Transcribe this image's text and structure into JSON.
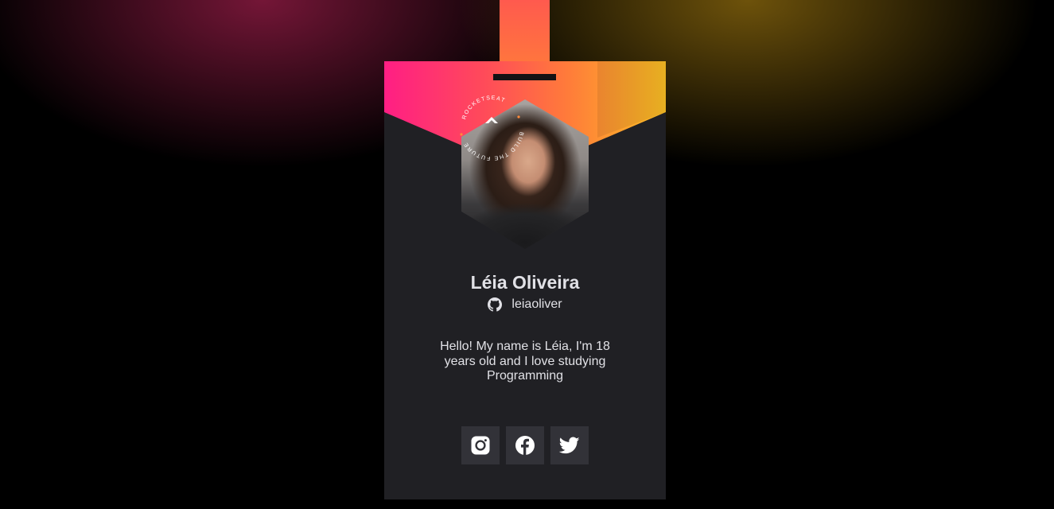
{
  "profile": {
    "name": "Léia Oliveira",
    "github_username": "leiaoliver",
    "bio": "Hello! My name is Léia, I'm 18 years old and I love studying Programming",
    "badge_text_top": "ROCKETSEAT",
    "badge_text_bottom": "BUILD THE FUTURE"
  },
  "socials": [
    {
      "icon": "instagram-icon"
    },
    {
      "icon": "facebook-icon"
    },
    {
      "icon": "twitter-icon"
    }
  ],
  "colors": {
    "page_background": "#000000",
    "card_background": "#202024",
    "social_button_background": "#323238",
    "text": "#e1e1e6",
    "gradient_start": "#ff1e84",
    "gradient_end": "#fbbf24"
  }
}
